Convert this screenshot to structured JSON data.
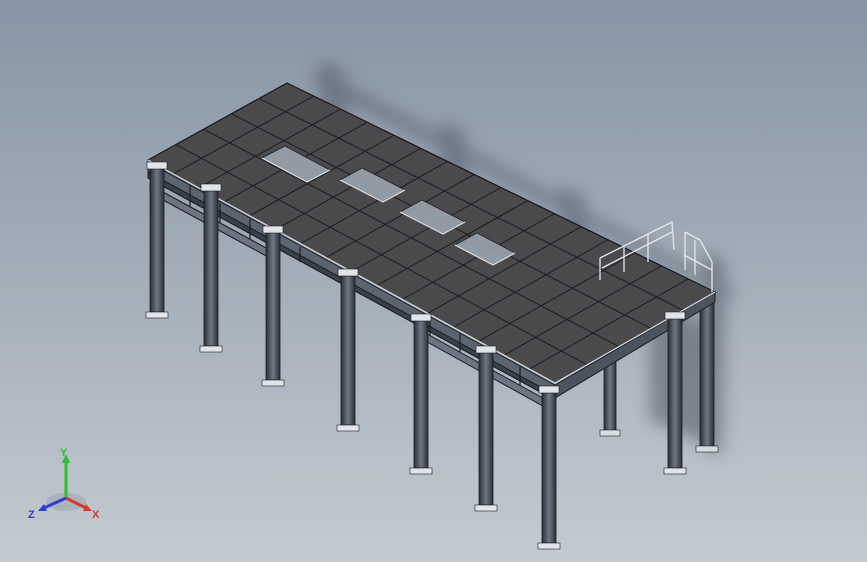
{
  "view": {
    "background_top": "#8795a4",
    "background_bottom": "#c4cad1",
    "deck_color": "#4a4a4c",
    "steel_color": "#5a6270",
    "edge_color": "#1a1c20",
    "shadow_color": "#5d6571"
  },
  "triad": {
    "y_label": "Y",
    "x_label": "X",
    "z_label": "Z",
    "y_color": "#2fbf2f",
    "x_color": "#d23a2a",
    "z_color": "#2a3fd2"
  }
}
